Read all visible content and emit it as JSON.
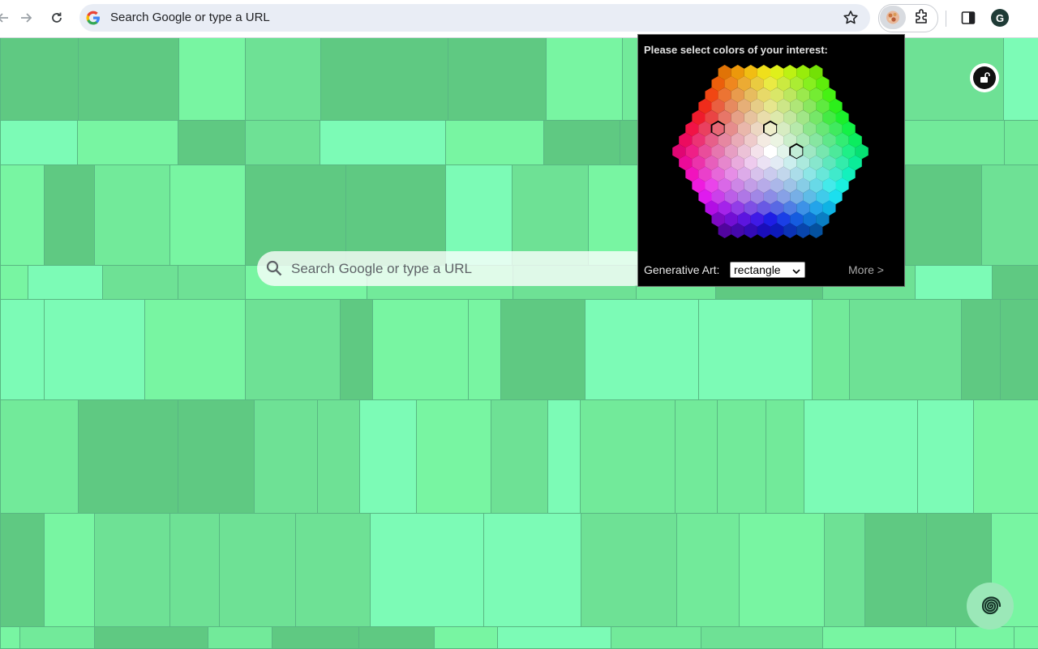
{
  "toolbar": {
    "omnibox_placeholder": "Search Google or type a URL",
    "profile_initial": "G"
  },
  "ntp": {
    "search_placeholder": "Search Google or type a URL"
  },
  "popup": {
    "prompt": "Please select colors of your interest:",
    "generative_art_label": "Generative Art:",
    "generative_art_value": "rectangle",
    "more_label": "More >"
  },
  "colors": {
    "tile_palette": [
      "#78f5a2",
      "#6ee195",
      "#5fc982",
      "#7cfbb6",
      "#72ea9a"
    ],
    "popup_bg": "#000000"
  }
}
